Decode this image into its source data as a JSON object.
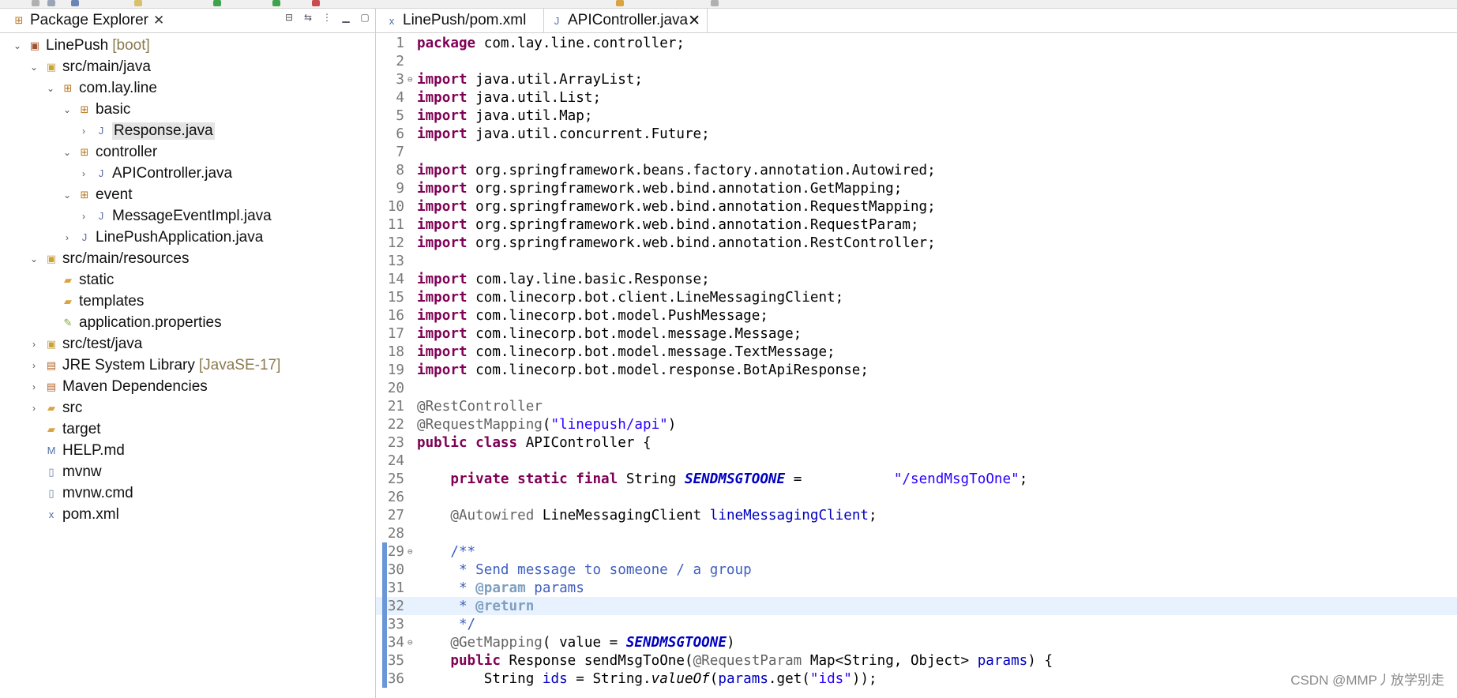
{
  "left_pane": {
    "tab_label": "Package Explorer",
    "tree": [
      {
        "label": "LinePush",
        "decoration": "[boot]",
        "indent": 0,
        "twisty": "expanded",
        "icon": "project-icon",
        "selected": false
      },
      {
        "label": "src/main/java",
        "decoration": "",
        "indent": 1,
        "twisty": "expanded",
        "icon": "source-folder-icon",
        "selected": false
      },
      {
        "label": "com.lay.line",
        "decoration": "",
        "indent": 2,
        "twisty": "expanded",
        "icon": "package-icon",
        "selected": false
      },
      {
        "label": "basic",
        "decoration": "",
        "indent": 3,
        "twisty": "expanded",
        "icon": "package-icon",
        "selected": false
      },
      {
        "label": "Response.java",
        "decoration": "",
        "indent": 4,
        "twisty": "collapsed",
        "icon": "java-file-icon",
        "selected": true
      },
      {
        "label": "controller",
        "decoration": "",
        "indent": 3,
        "twisty": "expanded",
        "icon": "package-icon",
        "selected": false
      },
      {
        "label": "APIController.java",
        "decoration": "",
        "indent": 4,
        "twisty": "collapsed",
        "icon": "java-file-icon",
        "selected": false
      },
      {
        "label": "event",
        "decoration": "",
        "indent": 3,
        "twisty": "expanded",
        "icon": "package-icon",
        "selected": false
      },
      {
        "label": "MessageEventImpl.java",
        "decoration": "",
        "indent": 4,
        "twisty": "collapsed",
        "icon": "java-file-icon",
        "selected": false
      },
      {
        "label": "LinePushApplication.java",
        "decoration": "",
        "indent": 3,
        "twisty": "collapsed",
        "icon": "java-file-icon",
        "selected": false
      },
      {
        "label": "src/main/resources",
        "decoration": "",
        "indent": 1,
        "twisty": "expanded",
        "icon": "source-folder-icon",
        "selected": false
      },
      {
        "label": "static",
        "decoration": "",
        "indent": 2,
        "twisty": "none",
        "icon": "folder-icon",
        "selected": false
      },
      {
        "label": "templates",
        "decoration": "",
        "indent": 2,
        "twisty": "none",
        "icon": "folder-icon",
        "selected": false
      },
      {
        "label": "application.properties",
        "decoration": "",
        "indent": 2,
        "twisty": "none",
        "icon": "properties-file-icon",
        "selected": false
      },
      {
        "label": "src/test/java",
        "decoration": "",
        "indent": 1,
        "twisty": "collapsed",
        "icon": "source-folder-icon",
        "selected": false
      },
      {
        "label": "JRE System Library",
        "decoration": "[JavaSE-17]",
        "indent": 1,
        "twisty": "collapsed",
        "icon": "library-icon",
        "selected": false
      },
      {
        "label": "Maven Dependencies",
        "decoration": "",
        "indent": 1,
        "twisty": "collapsed",
        "icon": "library-icon",
        "selected": false
      },
      {
        "label": "src",
        "decoration": "",
        "indent": 1,
        "twisty": "collapsed",
        "icon": "folder-icon",
        "selected": false
      },
      {
        "label": "target",
        "decoration": "",
        "indent": 1,
        "twisty": "none",
        "icon": "folder-icon",
        "selected": false
      },
      {
        "label": "HELP.md",
        "decoration": "",
        "indent": 1,
        "twisty": "none",
        "icon": "markdown-file-icon",
        "selected": false
      },
      {
        "label": "mvnw",
        "decoration": "",
        "indent": 1,
        "twisty": "none",
        "icon": "text-file-icon",
        "selected": false
      },
      {
        "label": "mvnw.cmd",
        "decoration": "",
        "indent": 1,
        "twisty": "none",
        "icon": "text-file-icon",
        "selected": false
      },
      {
        "label": "pom.xml",
        "decoration": "",
        "indent": 1,
        "twisty": "none",
        "icon": "xml-file-icon",
        "selected": false
      }
    ]
  },
  "editor": {
    "tabs": [
      {
        "label": "LinePush/pom.xml",
        "active": false,
        "icon": "xml-file-icon"
      },
      {
        "label": "APIController.java",
        "active": true,
        "icon": "java-file-icon"
      }
    ],
    "current_line": 32,
    "marked_lines": [
      29,
      30,
      31,
      32,
      33,
      34,
      35,
      36
    ],
    "lines": [
      {
        "n": "1",
        "fold": "",
        "tokens": [
          [
            "kw",
            "package"
          ],
          [
            "txt",
            " com.lay.line.controller;"
          ]
        ]
      },
      {
        "n": "2",
        "fold": "",
        "tokens": []
      },
      {
        "n": "3",
        "fold": "⊖",
        "tokens": [
          [
            "kw",
            "import"
          ],
          [
            "txt",
            " java.util.ArrayList;"
          ]
        ]
      },
      {
        "n": "4",
        "fold": "",
        "tokens": [
          [
            "kw",
            "import"
          ],
          [
            "txt",
            " java.util.List;"
          ]
        ]
      },
      {
        "n": "5",
        "fold": "",
        "tokens": [
          [
            "kw",
            "import"
          ],
          [
            "txt",
            " java.util.Map;"
          ]
        ]
      },
      {
        "n": "6",
        "fold": "",
        "tokens": [
          [
            "kw",
            "import"
          ],
          [
            "txt",
            " java.util.concurrent.Future;"
          ]
        ]
      },
      {
        "n": "7",
        "fold": "",
        "tokens": []
      },
      {
        "n": "8",
        "fold": "",
        "tokens": [
          [
            "kw",
            "import"
          ],
          [
            "txt",
            " org.springframework.beans.factory.annotation.Autowired;"
          ]
        ]
      },
      {
        "n": "9",
        "fold": "",
        "tokens": [
          [
            "kw",
            "import"
          ],
          [
            "txt",
            " org.springframework.web.bind.annotation.GetMapping;"
          ]
        ]
      },
      {
        "n": "10",
        "fold": "",
        "tokens": [
          [
            "kw",
            "import"
          ],
          [
            "txt",
            " org.springframework.web.bind.annotation.RequestMapping;"
          ]
        ]
      },
      {
        "n": "11",
        "fold": "",
        "tokens": [
          [
            "kw",
            "import"
          ],
          [
            "txt",
            " org.springframework.web.bind.annotation.RequestParam;"
          ]
        ]
      },
      {
        "n": "12",
        "fold": "",
        "tokens": [
          [
            "kw",
            "import"
          ],
          [
            "txt",
            " org.springframework.web.bind.annotation.RestController;"
          ]
        ]
      },
      {
        "n": "13",
        "fold": "",
        "tokens": []
      },
      {
        "n": "14",
        "fold": "",
        "tokens": [
          [
            "kw",
            "import"
          ],
          [
            "txt",
            " com.lay.line.basic.Response;"
          ]
        ]
      },
      {
        "n": "15",
        "fold": "",
        "tokens": [
          [
            "kw",
            "import"
          ],
          [
            "txt",
            " com.linecorp.bot.client.LineMessagingClient;"
          ]
        ]
      },
      {
        "n": "16",
        "fold": "",
        "tokens": [
          [
            "kw",
            "import"
          ],
          [
            "txt",
            " com.linecorp.bot.model.PushMessage;"
          ]
        ]
      },
      {
        "n": "17",
        "fold": "",
        "tokens": [
          [
            "kw",
            "import"
          ],
          [
            "txt",
            " com.linecorp.bot.model.message.Message;"
          ]
        ]
      },
      {
        "n": "18",
        "fold": "",
        "tokens": [
          [
            "kw",
            "import"
          ],
          [
            "txt",
            " com.linecorp.bot.model.message.TextMessage;"
          ]
        ]
      },
      {
        "n": "19",
        "fold": "",
        "tokens": [
          [
            "kw",
            "import"
          ],
          [
            "txt",
            " com.linecorp.bot.model.response.BotApiResponse;"
          ]
        ]
      },
      {
        "n": "20",
        "fold": "",
        "tokens": []
      },
      {
        "n": "21",
        "fold": "",
        "tokens": [
          [
            "ann",
            "@RestController"
          ]
        ]
      },
      {
        "n": "22",
        "fold": "",
        "tokens": [
          [
            "ann",
            "@RequestMapping"
          ],
          [
            "txt",
            "("
          ],
          [
            "str",
            "\"linepush/api\""
          ],
          [
            "txt",
            ")"
          ]
        ]
      },
      {
        "n": "23",
        "fold": "",
        "tokens": [
          [
            "kw",
            "public"
          ],
          [
            "txt",
            " "
          ],
          [
            "kw",
            "class"
          ],
          [
            "txt",
            " APIController {"
          ]
        ]
      },
      {
        "n": "24",
        "fold": "",
        "tokens": []
      },
      {
        "n": "25",
        "fold": "",
        "tokens": [
          [
            "txt",
            "    "
          ],
          [
            "kw",
            "private"
          ],
          [
            "txt",
            " "
          ],
          [
            "kw",
            "static"
          ],
          [
            "txt",
            " "
          ],
          [
            "kw",
            "final"
          ],
          [
            "txt",
            " String "
          ],
          [
            "sfld",
            "SENDMSGTOONE"
          ],
          [
            "txt",
            " =           "
          ],
          [
            "str",
            "\"/sendMsgToOne\""
          ],
          [
            "txt",
            ";"
          ]
        ]
      },
      {
        "n": "26",
        "fold": "",
        "tokens": []
      },
      {
        "n": "27",
        "fold": "",
        "tokens": [
          [
            "txt",
            "    "
          ],
          [
            "ann",
            "@Autowired"
          ],
          [
            "txt",
            " LineMessagingClient "
          ],
          [
            "fld",
            "lineMessagingClient"
          ],
          [
            "txt",
            ";"
          ]
        ]
      },
      {
        "n": "28",
        "fold": "",
        "tokens": []
      },
      {
        "n": "29",
        "fold": "⊖",
        "tokens": [
          [
            "txt",
            "    "
          ],
          [
            "cm",
            "/**"
          ]
        ]
      },
      {
        "n": "30",
        "fold": "",
        "tokens": [
          [
            "txt",
            "     "
          ],
          [
            "cm",
            "* Send message to someone / a group"
          ]
        ]
      },
      {
        "n": "31",
        "fold": "",
        "tokens": [
          [
            "txt",
            "     "
          ],
          [
            "cm",
            "* "
          ],
          [
            "tag",
            "@param"
          ],
          [
            "cm",
            " params"
          ]
        ]
      },
      {
        "n": "32",
        "fold": "",
        "tokens": [
          [
            "txt",
            "     "
          ],
          [
            "cm",
            "* "
          ],
          [
            "tag",
            "@return"
          ]
        ]
      },
      {
        "n": "33",
        "fold": "",
        "tokens": [
          [
            "txt",
            "     "
          ],
          [
            "cm",
            "*/"
          ]
        ]
      },
      {
        "n": "34",
        "fold": "⊖",
        "tokens": [
          [
            "txt",
            "    "
          ],
          [
            "ann",
            "@GetMapping"
          ],
          [
            "txt",
            "( value = "
          ],
          [
            "sfld",
            "SENDMSGTOONE"
          ],
          [
            "txt",
            ")"
          ]
        ]
      },
      {
        "n": "35",
        "fold": "",
        "tokens": [
          [
            "txt",
            "    "
          ],
          [
            "kw",
            "public"
          ],
          [
            "txt",
            " Response sendMsgToOne("
          ],
          [
            "ann",
            "@RequestParam"
          ],
          [
            "txt",
            " Map<String, Object> "
          ],
          [
            "fld",
            "params"
          ],
          [
            "txt",
            ") {"
          ]
        ]
      },
      {
        "n": "36",
        "fold": "",
        "tokens": [
          [
            "txt",
            "        String "
          ],
          [
            "fld",
            "ids"
          ],
          [
            "txt",
            " = String."
          ],
          [
            "smeth",
            "valueOf"
          ],
          [
            "txt",
            "("
          ],
          [
            "fld",
            "params"
          ],
          [
            "txt",
            ".get("
          ],
          [
            "str",
            "\"ids\""
          ],
          [
            "txt",
            "));"
          ]
        ]
      }
    ]
  },
  "watermark": "CSDN @MMP丿放学别走",
  "icons": {
    "project-icon": {
      "glyph": "▣",
      "color": "#a0522d"
    },
    "source-folder-icon": {
      "glyph": "▣",
      "color": "#c9a23c"
    },
    "package-icon": {
      "glyph": "⊞",
      "color": "#b8741a"
    },
    "java-file-icon": {
      "glyph": "J",
      "color": "#5a6fa8"
    },
    "folder-icon": {
      "glyph": "▰",
      "color": "#d9a441"
    },
    "properties-file-icon": {
      "glyph": "✎",
      "color": "#7aa52a"
    },
    "library-icon": {
      "glyph": "▤",
      "color": "#b5652c"
    },
    "markdown-file-icon": {
      "glyph": "M",
      "color": "#4d6fa8"
    },
    "text-file-icon": {
      "glyph": "▯",
      "color": "#6a7f9f"
    },
    "xml-file-icon": {
      "glyph": "x",
      "color": "#4d6fa8"
    }
  }
}
